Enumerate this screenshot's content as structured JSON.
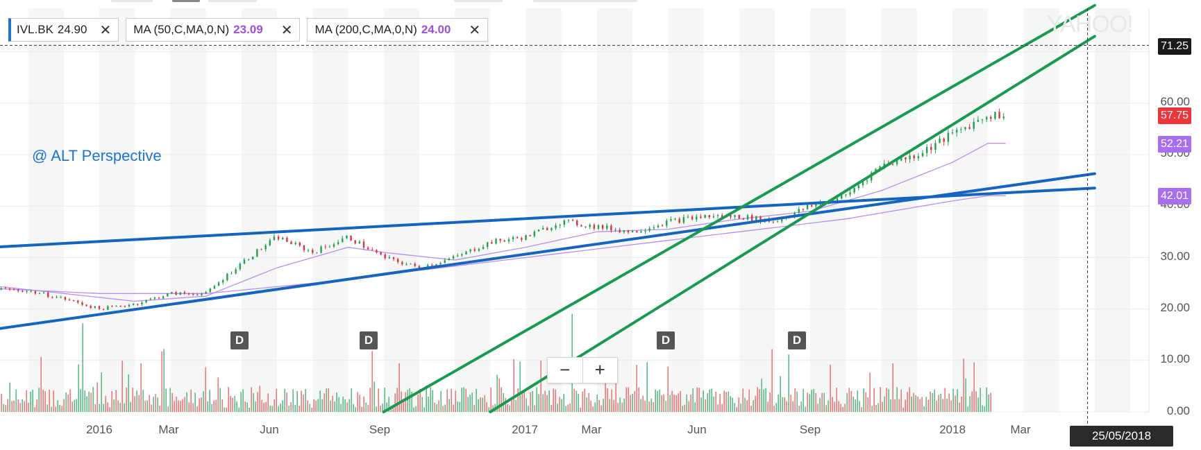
{
  "legend": [
    {
      "label": "IVL.BK",
      "value": "24.90",
      "accent": "#1e73d8"
    },
    {
      "label": "MA (50,C,MA,0,N)",
      "value": "23.09",
      "value_color": "#9b51e0"
    },
    {
      "label": "MA (200,C,MA,0,N)",
      "value": "24.00",
      "value_color": "#9b51e0"
    }
  ],
  "watermark": "YAHOO!",
  "annotation": "@ ALT Perspective",
  "crosshair": {
    "price": "71.25",
    "date": "25/05/2018"
  },
  "last_price_tags": [
    {
      "value": "57.75",
      "color": "#f0343c"
    },
    {
      "value": "52.21",
      "color": "#a86ef0"
    },
    {
      "value": "42.01",
      "color": "#a86ef0"
    }
  ],
  "dividend_markers": [
    {
      "label": "D",
      "date": "2016-05"
    },
    {
      "label": "D",
      "date": "2016-08"
    },
    {
      "label": "D",
      "date": "2017-05"
    },
    {
      "label": "D",
      "date": "2017-08"
    }
  ],
  "zoom": {
    "minus": "−",
    "plus": "+"
  },
  "chart_data": {
    "type": "line",
    "xlabel": "",
    "ylabel": "",
    "ylim": [
      0,
      75
    ],
    "yticks": [
      "0.00",
      "10.00",
      "20.00",
      "30.00",
      "40.00",
      "50.00",
      "60.00"
    ],
    "xticks": [
      "2016",
      "Mar",
      "Jun",
      "Sep",
      "2017",
      "Mar",
      "Jun",
      "Sep",
      "2018",
      "Mar"
    ],
    "xrange": [
      "2015-10",
      "2018-05"
    ],
    "grid": true,
    "series": [
      {
        "name": "IVL.BK",
        "color": "#1fa34a",
        "x": [
          "2015-10",
          "2015-11",
          "2015-12",
          "2016-01",
          "2016-02",
          "2016-03",
          "2016-04",
          "2016-05",
          "2016-06",
          "2016-07",
          "2016-08",
          "2016-09",
          "2016-10",
          "2016-11",
          "2016-12",
          "2017-01",
          "2017-02",
          "2017-03",
          "2017-04",
          "2017-05",
          "2017-06",
          "2017-07",
          "2017-08",
          "2017-09",
          "2017-10",
          "2017-11",
          "2017-12",
          "2018-01",
          "2018-02"
        ],
        "values": [
          24,
          23.5,
          22,
          20,
          21,
          23,
          23,
          29,
          34,
          31,
          34,
          30,
          28,
          30,
          33,
          34,
          37,
          36,
          35,
          37,
          38,
          38,
          37,
          40,
          42,
          48,
          50,
          54,
          57.75
        ]
      },
      {
        "name": "MA (50,C,MA,0,N)",
        "color": "#b98ef0",
        "x": [
          "2015-10",
          "2015-12",
          "2016-02",
          "2016-04",
          "2016-06",
          "2016-08",
          "2016-09",
          "2016-11",
          "2017-01",
          "2017-03",
          "2017-05",
          "2017-07",
          "2017-09",
          "2017-11",
          "2018-01",
          "2018-02"
        ],
        "values": [
          24.5,
          23,
          21.5,
          22.5,
          28,
          32,
          31,
          29.5,
          32,
          35,
          35.5,
          37.5,
          39,
          43,
          48.5,
          52.21
        ]
      },
      {
        "name": "MA (200,C,MA,0,N)",
        "color": "#b98ef0",
        "x": [
          "2015-10",
          "2016-01",
          "2016-04",
          "2016-07",
          "2016-10",
          "2017-01",
          "2017-04",
          "2017-07",
          "2017-10",
          "2018-01",
          "2018-02"
        ],
        "values": [
          24,
          23,
          23,
          25,
          27.5,
          30,
          32.5,
          35,
          37.5,
          41,
          42.01
        ]
      }
    ],
    "volume": {
      "color_up": "#3cb371",
      "color_down": "#f06060",
      "approx_range": [
        0,
        20
      ]
    },
    "trendlines": [
      {
        "color": "#1565c0",
        "from": [
          "2015-10",
          32
        ],
        "to": [
          "2018-05",
          43.5
        ]
      },
      {
        "color": "#1565c0",
        "from": [
          "2015-10",
          16
        ],
        "to": [
          "2018-05",
          46.3
        ]
      },
      {
        "color": "#1a9a50",
        "from": [
          "2016-09",
          0
        ],
        "to": [
          "2018-05",
          79
        ]
      },
      {
        "color": "#1a9a50",
        "from": [
          "2016-12",
          0
        ],
        "to": [
          "2018-05",
          73
        ]
      }
    ]
  }
}
